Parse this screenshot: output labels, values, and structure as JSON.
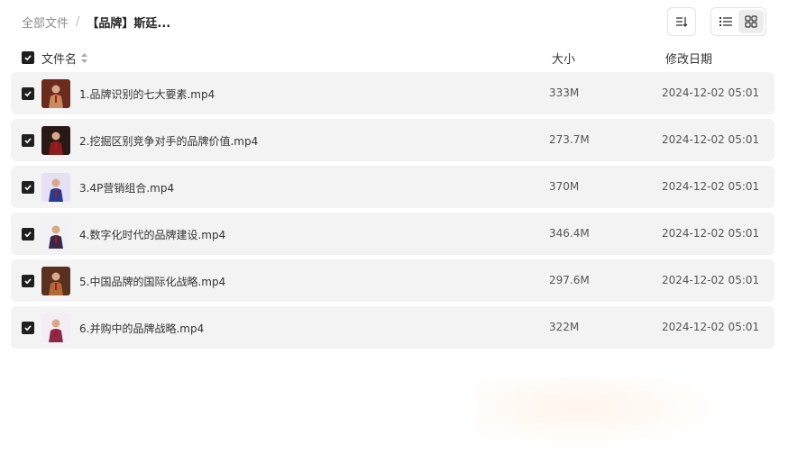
{
  "breadcrumb": {
    "root": "全部文件",
    "separator": "/",
    "current": "【品牌】斯廷..."
  },
  "toolbar": {
    "sort_icon": "sort-icon",
    "list_view_icon": "list-view-icon",
    "grid_view_icon": "grid-view-icon",
    "active_view": "list"
  },
  "columns": {
    "name": "文件名",
    "size": "大小",
    "date": "修改日期"
  },
  "files": [
    {
      "name": "1.品牌识别的七大要素.mp4",
      "size": "333M",
      "date": "2024-12-02 05:01",
      "checked": true,
      "thumb_colors": [
        "#6b2c1f",
        "#c98b5c"
      ]
    },
    {
      "name": "2.挖掘区别竞争对手的品牌价值.mp4",
      "size": "273.7M",
      "date": "2024-12-02 05:01",
      "checked": true,
      "thumb_colors": [
        "#2a1816",
        "#8a1e1e"
      ]
    },
    {
      "name": "3.4P营销组合.mp4",
      "size": "370M",
      "date": "2024-12-02 05:01",
      "checked": true,
      "thumb_colors": [
        "#e6e0f4",
        "#2b3a8f"
      ]
    },
    {
      "name": "4.数字化时代的品牌建设.mp4",
      "size": "346.4M",
      "date": "2024-12-02 05:01",
      "checked": true,
      "thumb_colors": [
        "#f2f2f5",
        "#3a2a4a"
      ]
    },
    {
      "name": "5.中国品牌的国际化战略.mp4",
      "size": "297.6M",
      "date": "2024-12-02 05:01",
      "checked": true,
      "thumb_colors": [
        "#5a3020",
        "#b06a3a"
      ]
    },
    {
      "name": "6.并购中的品牌战略.mp4",
      "size": "322M",
      "date": "2024-12-02 05:01",
      "checked": true,
      "thumb_colors": [
        "#f4eef4",
        "#8a2a4a"
      ]
    }
  ]
}
